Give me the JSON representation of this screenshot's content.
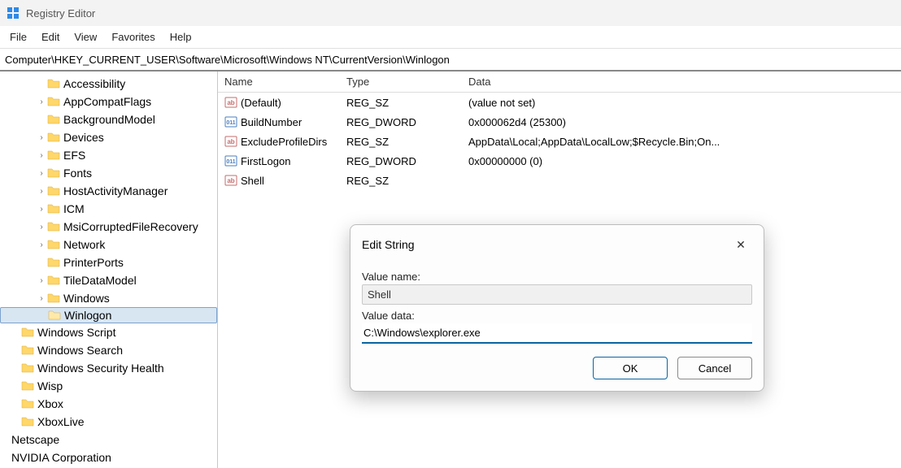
{
  "window": {
    "title": "Registry Editor"
  },
  "menubar": [
    "File",
    "Edit",
    "View",
    "Favorites",
    "Help"
  ],
  "address": "Computer\\HKEY_CURRENT_USER\\Software\\Microsoft\\Windows NT\\CurrentVersion\\Winlogon",
  "tree": [
    {
      "indent": 44,
      "chev": "",
      "label": "Accessibility"
    },
    {
      "indent": 44,
      "chev": "›",
      "label": "AppCompatFlags"
    },
    {
      "indent": 44,
      "chev": "",
      "label": "BackgroundModel"
    },
    {
      "indent": 44,
      "chev": "›",
      "label": "Devices"
    },
    {
      "indent": 44,
      "chev": "›",
      "label": "EFS"
    },
    {
      "indent": 44,
      "chev": "›",
      "label": "Fonts"
    },
    {
      "indent": 44,
      "chev": "›",
      "label": "HostActivityManager"
    },
    {
      "indent": 44,
      "chev": "›",
      "label": "ICM"
    },
    {
      "indent": 44,
      "chev": "›",
      "label": "MsiCorruptedFileRecovery"
    },
    {
      "indent": 44,
      "chev": "›",
      "label": "Network"
    },
    {
      "indent": 44,
      "chev": "",
      "label": "PrinterPorts"
    },
    {
      "indent": 44,
      "chev": "›",
      "label": "TileDataModel"
    },
    {
      "indent": 44,
      "chev": "›",
      "label": "Windows"
    },
    {
      "indent": 44,
      "chev": "",
      "label": "Winlogon",
      "selected": true
    },
    {
      "indent": 12,
      "chev": "",
      "label": "Windows Script"
    },
    {
      "indent": 12,
      "chev": "",
      "label": "Windows Search"
    },
    {
      "indent": 12,
      "chev": "",
      "label": "Windows Security Health"
    },
    {
      "indent": 12,
      "chev": "",
      "label": "Wisp"
    },
    {
      "indent": 12,
      "chev": "",
      "label": "Xbox"
    },
    {
      "indent": 12,
      "chev": "",
      "label": "XboxLive"
    },
    {
      "indent": 0,
      "chev": "",
      "label": "Netscape",
      "nofolder": true
    },
    {
      "indent": 0,
      "chev": "",
      "label": "NVIDIA Corporation",
      "nofolder": true
    }
  ],
  "columns": {
    "name": "Name",
    "type": "Type",
    "data": "Data"
  },
  "values": [
    {
      "icon": "str",
      "name": "(Default)",
      "type": "REG_SZ",
      "data": "(value not set)"
    },
    {
      "icon": "bin",
      "name": "BuildNumber",
      "type": "REG_DWORD",
      "data": "0x000062d4 (25300)"
    },
    {
      "icon": "str",
      "name": "ExcludeProfileDirs",
      "type": "REG_SZ",
      "data": "AppData\\Local;AppData\\LocalLow;$Recycle.Bin;On..."
    },
    {
      "icon": "bin",
      "name": "FirstLogon",
      "type": "REG_DWORD",
      "data": "0x00000000 (0)"
    },
    {
      "icon": "str",
      "name": "Shell",
      "type": "REG_SZ",
      "data": ""
    }
  ],
  "dialog": {
    "title": "Edit String",
    "valueNameLabel": "Value name:",
    "valueName": "Shell",
    "valueDataLabel": "Value data:",
    "valueData": "C:\\Windows\\explorer.exe",
    "ok": "OK",
    "cancel": "Cancel"
  }
}
